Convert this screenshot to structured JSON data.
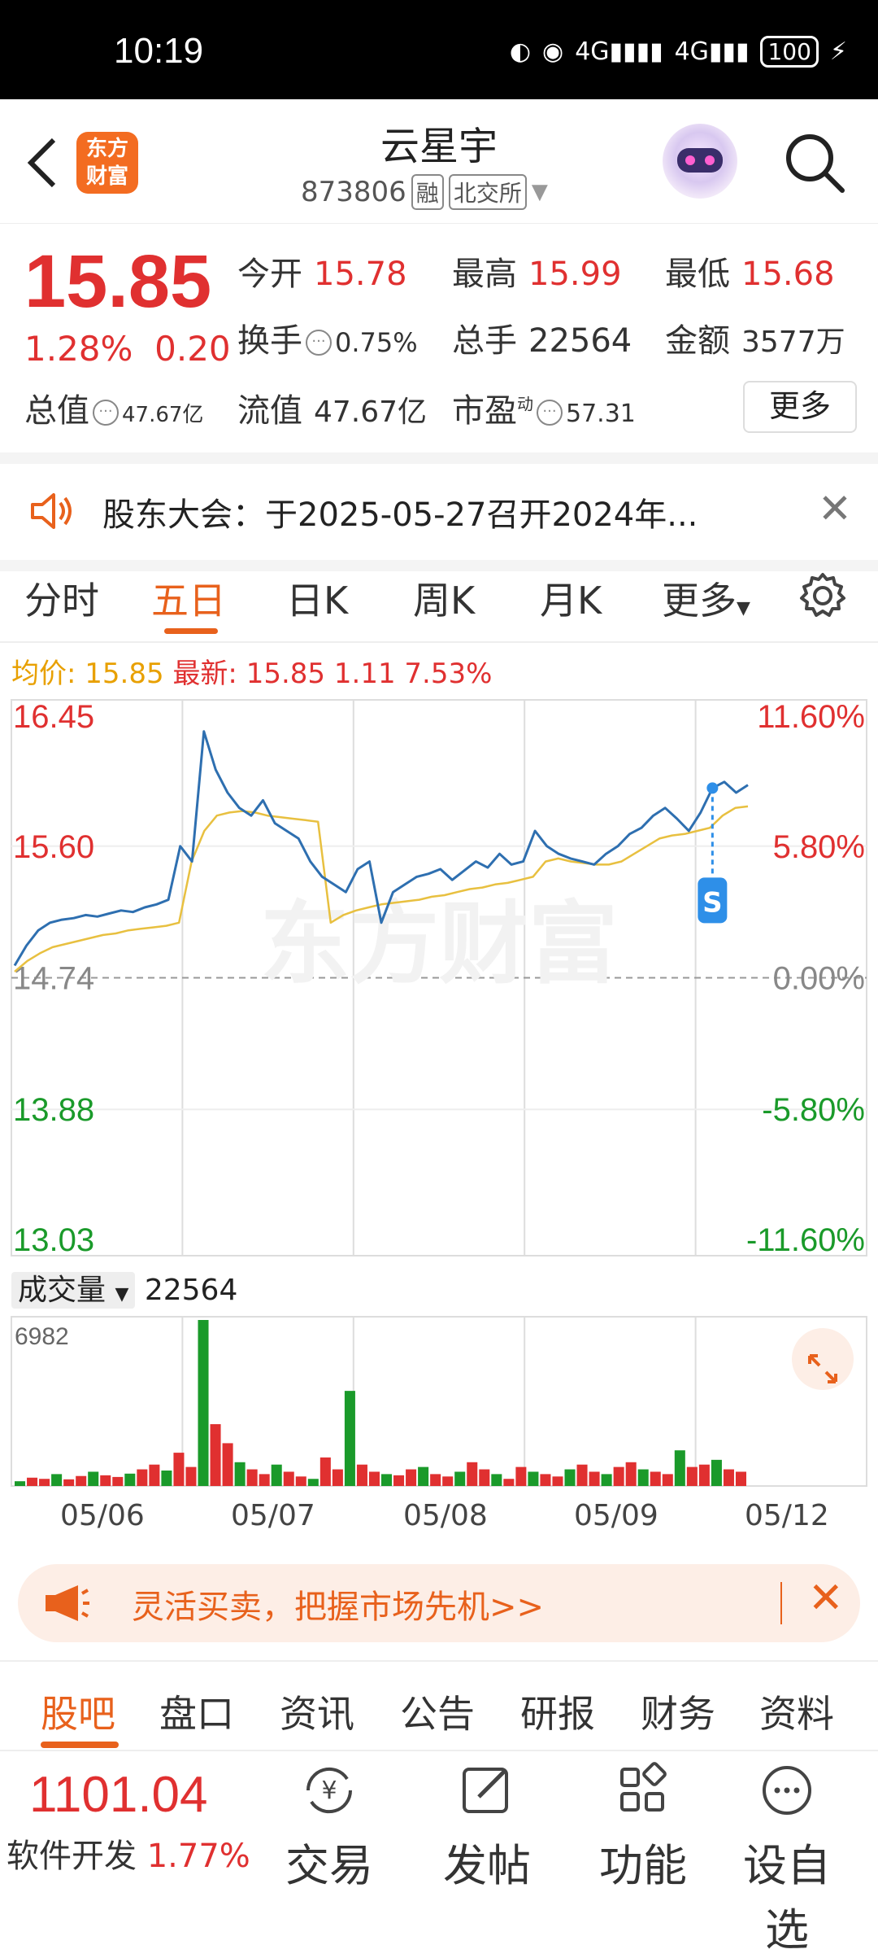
{
  "status": {
    "time": "10:19",
    "battery": "100"
  },
  "header": {
    "back_icon": "chevron-left-icon",
    "logo_text": "东方财富",
    "title": "云星宇",
    "code": "873806",
    "tag_rong": "融",
    "exchange": "北交所"
  },
  "quote": {
    "price": "15.85",
    "change_pct": "1.28%",
    "change_val": "0.20",
    "open_label": "今开",
    "open": "15.78",
    "high_label": "最高",
    "high": "15.99",
    "low_label": "最低",
    "low": "15.68",
    "turnover_label": "换手",
    "turnover": "0.75%",
    "volume_label": "总手",
    "volume": "22564",
    "amount_label": "金额",
    "amount": "3577万",
    "mktcap_label": "总值",
    "mktcap": "47.67亿",
    "float_label": "流值",
    "float_cap": "47.67亿",
    "pe_label": "市盈",
    "pe_sup": "动",
    "pe": "57.31",
    "more": "更多"
  },
  "notice": {
    "text": "股东大会：于2025-05-27召开2024年..."
  },
  "tabs": [
    "分时",
    "五日",
    "日K",
    "周K",
    "月K",
    "更多"
  ],
  "active_tab": "五日",
  "avg": {
    "avg_label": "均价:",
    "avg": "15.85",
    "latest_label": "最新:",
    "latest": "15.85",
    "chg": "1.11",
    "chg_pct": "7.53%"
  },
  "chart_data": {
    "type": "line",
    "title": "",
    "y_left_ticks": [
      "16.45",
      "15.60",
      "14.74",
      "13.88",
      "13.03"
    ],
    "y_right_ticks": [
      "11.60%",
      "5.80%",
      "0.00%",
      "-5.80%",
      "-11.60%"
    ],
    "ylim": [
      13.03,
      16.45
    ],
    "prev_close": 14.74,
    "days": [
      "05/06",
      "05/07",
      "05/08",
      "05/09",
      "05/12"
    ],
    "series": [
      {
        "values": [
          14.82,
          14.95,
          15.05,
          15.1,
          15.12,
          15.13,
          15.15,
          15.14,
          15.16,
          15.18,
          15.17,
          15.2,
          15.22,
          15.25,
          15.6,
          15.5,
          16.35,
          16.1,
          15.95,
          15.85,
          15.8,
          15.9,
          15.75,
          15.7,
          15.65,
          15.5,
          15.4,
          15.35,
          15.3,
          15.45,
          15.5,
          15.1,
          15.3,
          15.35,
          15.4,
          15.42,
          15.45,
          15.38,
          15.44,
          15.5,
          15.46,
          15.55,
          15.48,
          15.5,
          15.7,
          15.6,
          15.55,
          15.52,
          15.5,
          15.48,
          15.55,
          15.6,
          15.68,
          15.72,
          15.8,
          15.85,
          15.78,
          15.7,
          15.82,
          15.98,
          16.02,
          15.95,
          16.0
        ]
      },
      {
        "values": [
          14.78,
          14.85,
          14.9,
          14.94,
          14.96,
          14.98,
          15.0,
          15.02,
          15.03,
          15.05,
          15.06,
          15.07,
          15.08,
          15.1,
          15.5,
          15.7,
          15.8,
          15.82,
          15.83,
          15.82,
          15.8,
          15.79,
          15.78,
          15.77,
          15.76,
          15.1,
          15.15,
          15.18,
          15.2,
          15.22,
          15.23,
          15.24,
          15.25,
          15.27,
          15.28,
          15.3,
          15.32,
          15.33,
          15.35,
          15.36,
          15.38,
          15.4,
          15.5,
          15.52,
          15.5,
          15.49,
          15.48,
          15.48,
          15.5,
          15.55,
          15.6,
          15.65,
          15.67,
          15.68,
          15.7,
          15.72,
          15.8,
          15.85,
          15.86
        ]
      }
    ],
    "volume_label": "成交量",
    "volume_total": "22564",
    "volume_max_tick": "6982",
    "volume": [
      200,
      350,
      300,
      500,
      280,
      420,
      600,
      450,
      380,
      520,
      700,
      900,
      650,
      1400,
      800,
      6982,
      2600,
      1800,
      1000,
      700,
      500,
      900,
      600,
      400,
      300,
      1200,
      700,
      4000,
      900,
      600,
      500,
      450,
      700,
      800,
      500,
      400,
      600,
      1000,
      700,
      500,
      300,
      800,
      600,
      500,
      400,
      700,
      900,
      600,
      500,
      800,
      1000,
      700,
      600,
      500,
      1500,
      800,
      900,
      1100,
      700,
      600
    ]
  },
  "promo": {
    "text": "灵活买卖，把握市场先机>>"
  },
  "info_tabs": [
    "股吧",
    "盘口",
    "资讯",
    "公告",
    "研报",
    "财务",
    "资料"
  ],
  "active_info_tab": "股吧",
  "bottom": {
    "index_value": "1101.04",
    "index_name": "软件开发",
    "index_pct": "1.77%",
    "trade": "交易",
    "post": "发帖",
    "func": "功能",
    "watch": "设自选"
  }
}
